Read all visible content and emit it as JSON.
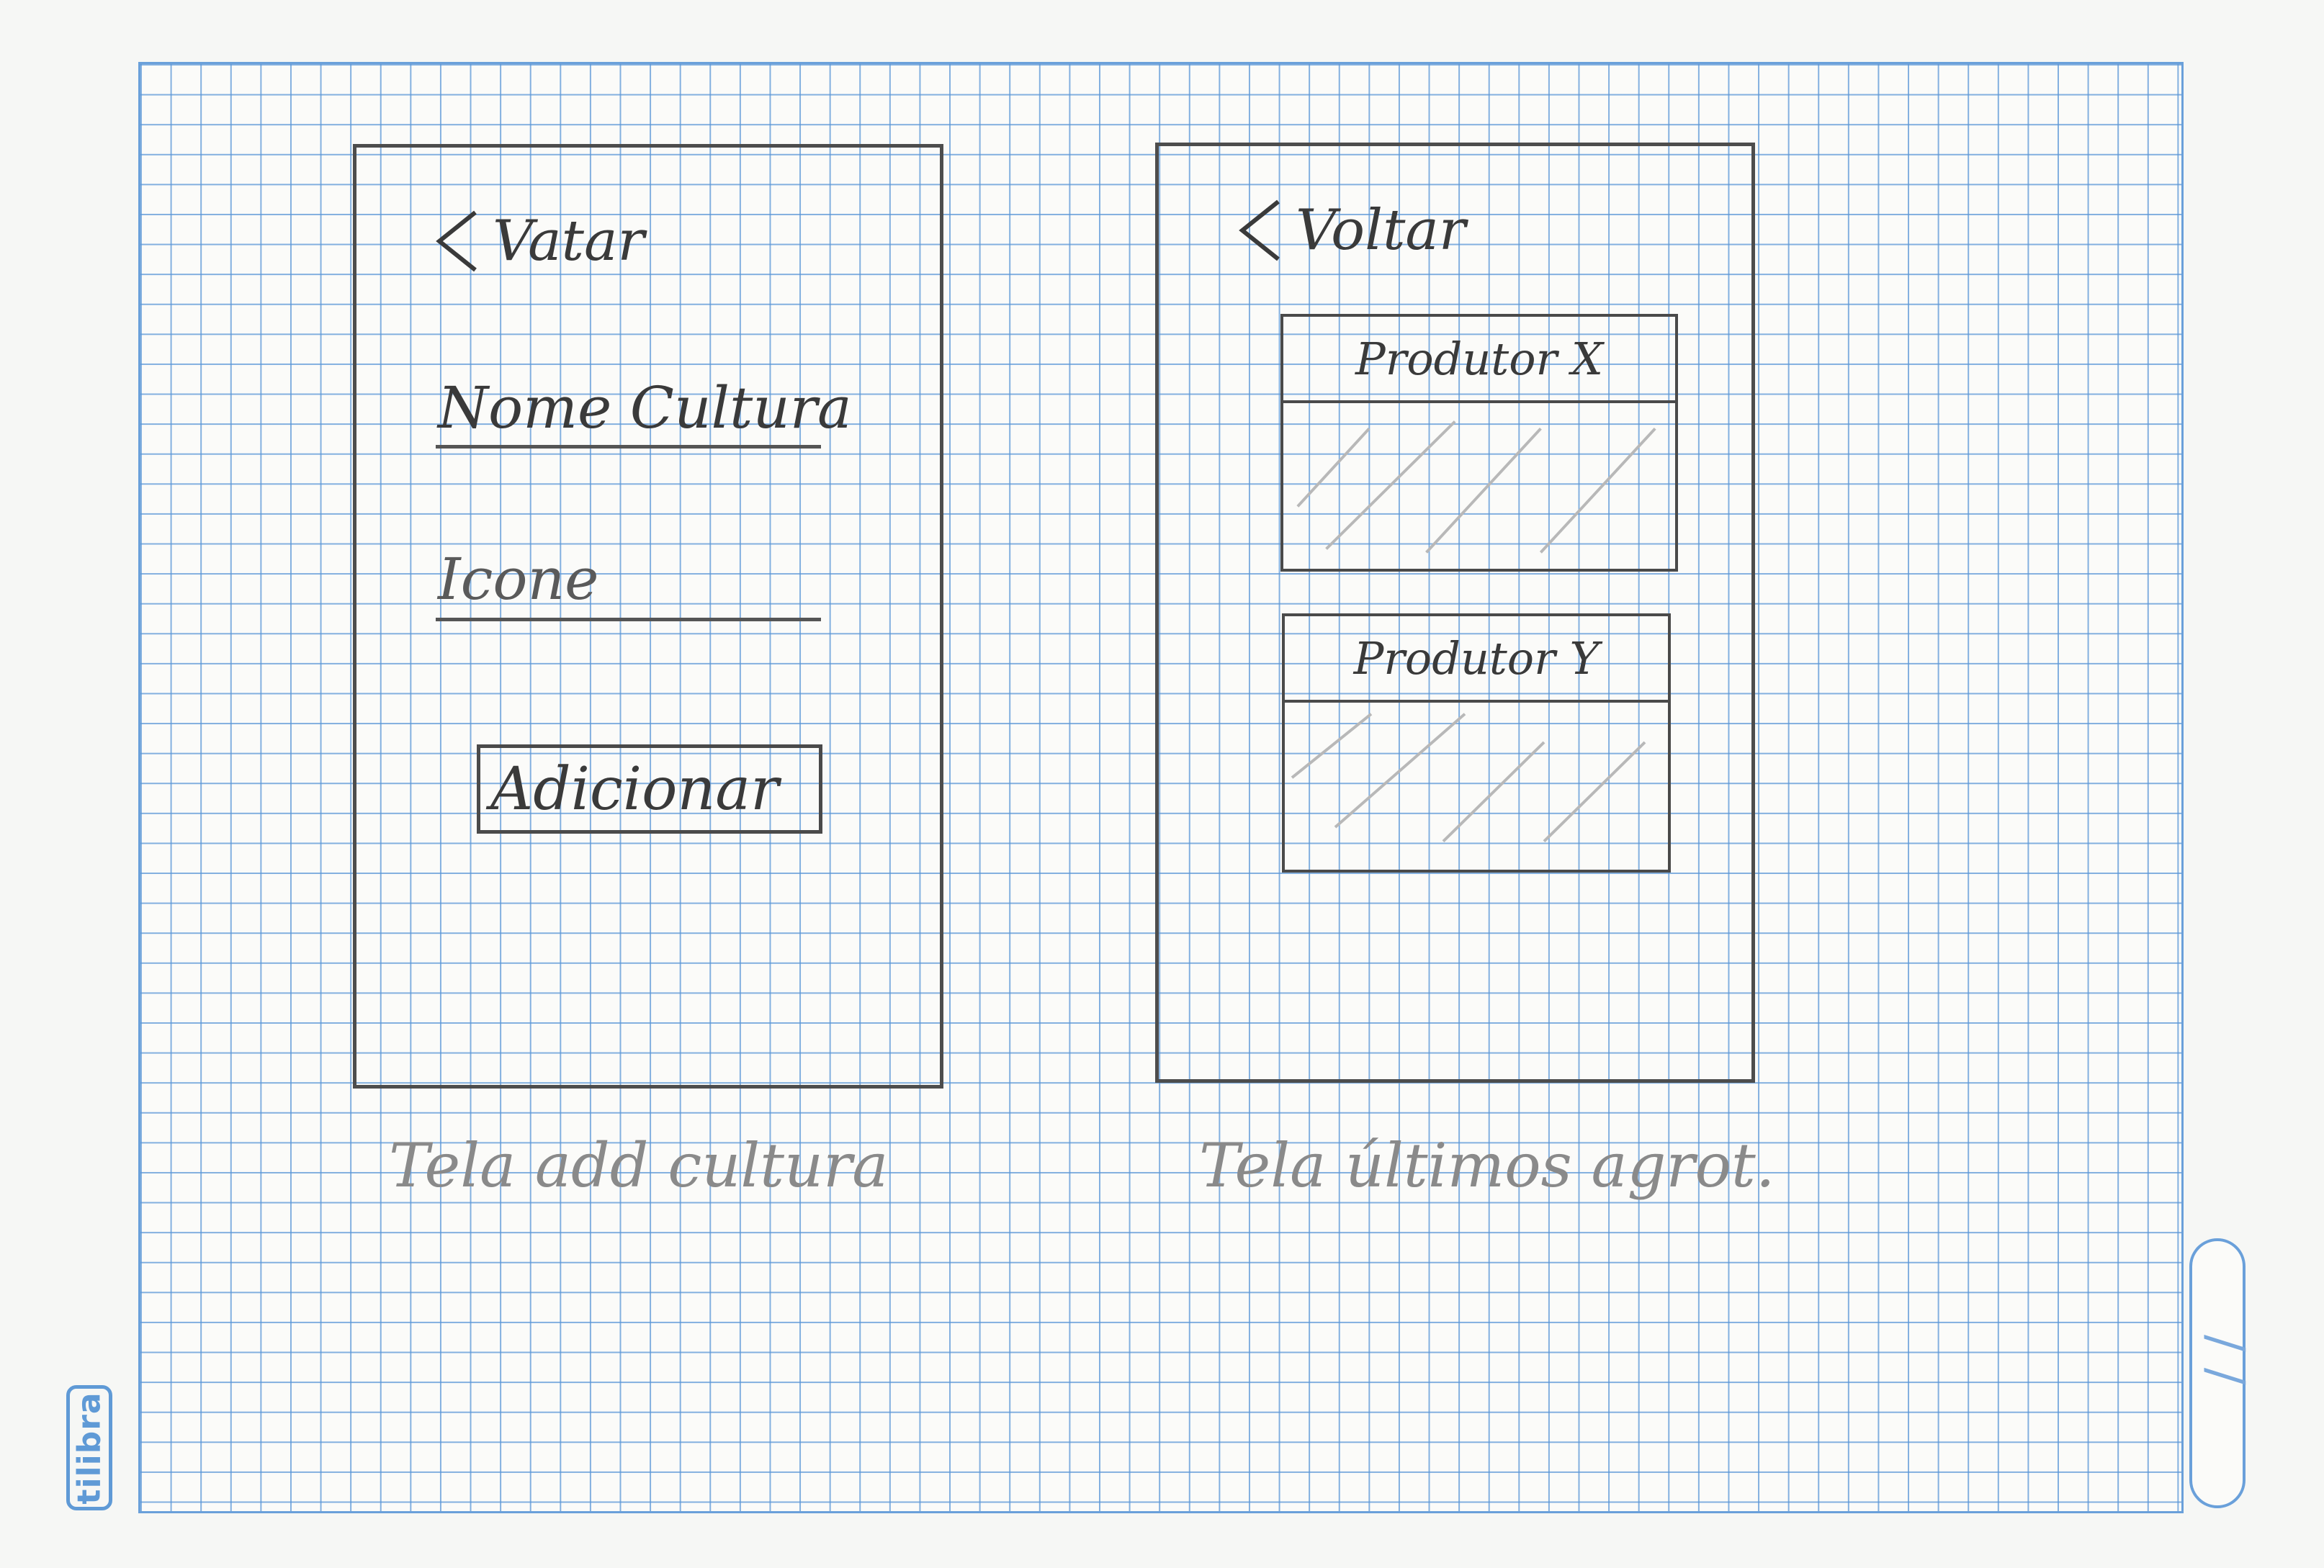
{
  "screens": [
    {
      "back_label": "Vatar",
      "fields": [
        "Nome Cultura",
        "Icone"
      ],
      "button_label": "Adicionar",
      "caption": "Tela add cultura"
    },
    {
      "back_label": "Voltar",
      "cards": [
        {
          "title": "Produtor X"
        },
        {
          "title": "Produtor Y"
        }
      ],
      "caption": "Tela últimos agrot."
    }
  ],
  "paper": {
    "brand": "tilibra",
    "date_mark": "/ /"
  },
  "colors": {
    "grid": "#5a96d7",
    "pencil": "#4a4a4a"
  }
}
